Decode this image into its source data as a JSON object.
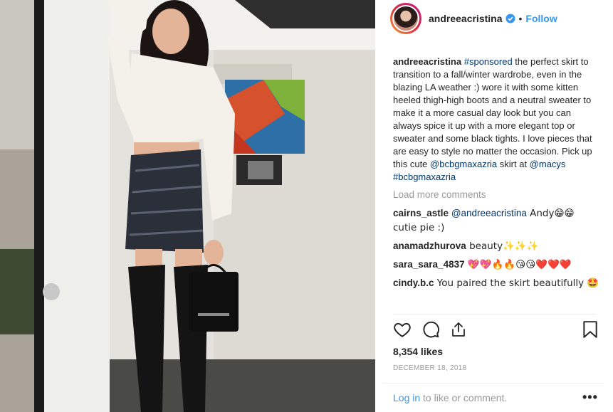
{
  "post": {
    "username": "andreeacristina",
    "follow_label": "Follow",
    "caption_user": "andreeacristina",
    "caption_hashtag": "#sponsored",
    "caption_text": " the perfect skirt to transition to a fall/winter wardrobe, even in the blazing LA weather :) wore it with some kitten heeled thigh-high boots and a neutral sweater to make it a more casual day look but you can always spice it up with a more elegant top or sweater and some black tights. I love pieces that are easy to style no matter the occasion. Pick up this cute ",
    "caption_mention1": "@bcbgmaxazria",
    "caption_text2": " skirt at ",
    "caption_mention2": "@macys",
    "caption_text3": " ",
    "caption_hashtag2": "#bcbgmaxazria",
    "load_more": "Load more comments",
    "likes": "8,354 likes",
    "date": "DECEMBER 18, 2018",
    "login_link": "Log in",
    "login_text": " to like or comment.",
    "more_label": "•••"
  },
  "comments": [
    {
      "user": "cairns_astle",
      "mention": "@andreeacristina",
      "text": " Andy😁😁 cutie pie :)"
    },
    {
      "user": "anamadzhurova",
      "mention": "",
      "text": " beauty✨✨✨"
    },
    {
      "user": "sara_sara_4837",
      "mention": "",
      "text": " 💖💖🔥🔥😘😘❤️❤️❤️"
    },
    {
      "user": "cindy.b.c",
      "mention": "",
      "text": " You paired the skirt beautifully 🤩"
    }
  ],
  "colors": {
    "link_blue": "#3897f0",
    "mention_blue": "#003569",
    "muted": "#999999"
  },
  "icons": [
    "verified-badge-icon",
    "heart-icon",
    "comment-icon",
    "share-icon",
    "bookmark-icon"
  ]
}
